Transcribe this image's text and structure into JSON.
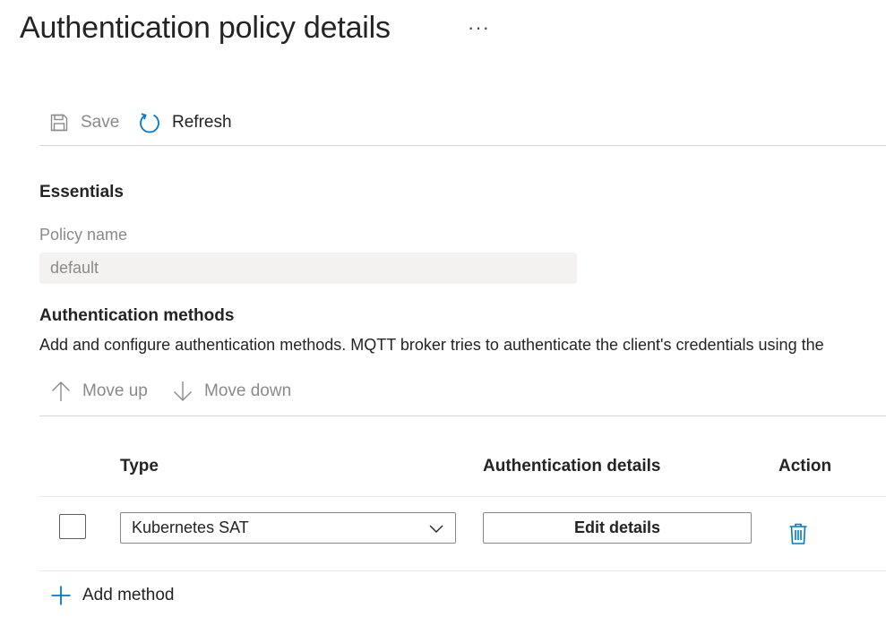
{
  "header": {
    "title": "Authentication policy details",
    "more_label": "···"
  },
  "toolbar": {
    "save_label": "Save",
    "refresh_label": "Refresh"
  },
  "essentials": {
    "heading": "Essentials",
    "policy_name_label": "Policy name",
    "policy_name_value": "default"
  },
  "auth_methods": {
    "heading": "Authentication methods",
    "description": "Add and configure authentication methods. MQTT broker tries to authenticate the client's credentials using the",
    "move_up_label": "Move up",
    "move_down_label": "Move down",
    "columns": {
      "type": "Type",
      "auth_details": "Authentication details",
      "action": "Action"
    },
    "rows": [
      {
        "type_value": "Kubernetes SAT",
        "details_button": "Edit details",
        "checked": false
      }
    ],
    "add_method_label": "Add method"
  },
  "colors": {
    "accent": "#0078d4",
    "text": "#242424",
    "disabled": "#8a8a8a",
    "input_bg": "#f3f2f1"
  },
  "icons": {
    "save": "save-icon",
    "refresh": "refresh-icon",
    "move_up": "arrow-up-icon",
    "move_down": "arrow-down-icon",
    "dropdown": "chevron-down-icon",
    "delete": "trash-icon",
    "add": "plus-icon",
    "more": "more-icon"
  }
}
